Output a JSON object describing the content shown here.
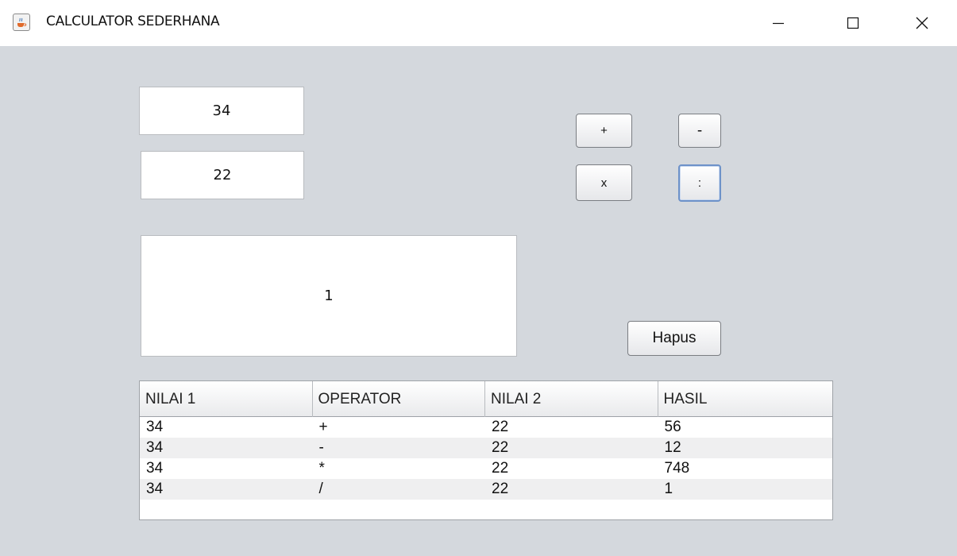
{
  "window": {
    "title": "CALCULATOR SEDERHANA",
    "icon": "java-cup-icon"
  },
  "inputs": {
    "nilai1": "34",
    "nilai2": "22"
  },
  "result": "1",
  "operators": {
    "add": "+",
    "subtract": "-",
    "multiply": "x",
    "divide": ":"
  },
  "clear_label": "Hapus",
  "table": {
    "columns": [
      "NILAI 1",
      "OPERATOR",
      "NILAI 2",
      "HASIL"
    ],
    "rows": [
      [
        "34",
        "+",
        "22",
        "56"
      ],
      [
        "34",
        "-",
        "22",
        "12"
      ],
      [
        "34",
        "*",
        "22",
        "748"
      ],
      [
        "34",
        "/",
        "22",
        "1"
      ]
    ]
  },
  "colors": {
    "background": "#d4d8dd",
    "focus_ring": "#6d92c9"
  }
}
